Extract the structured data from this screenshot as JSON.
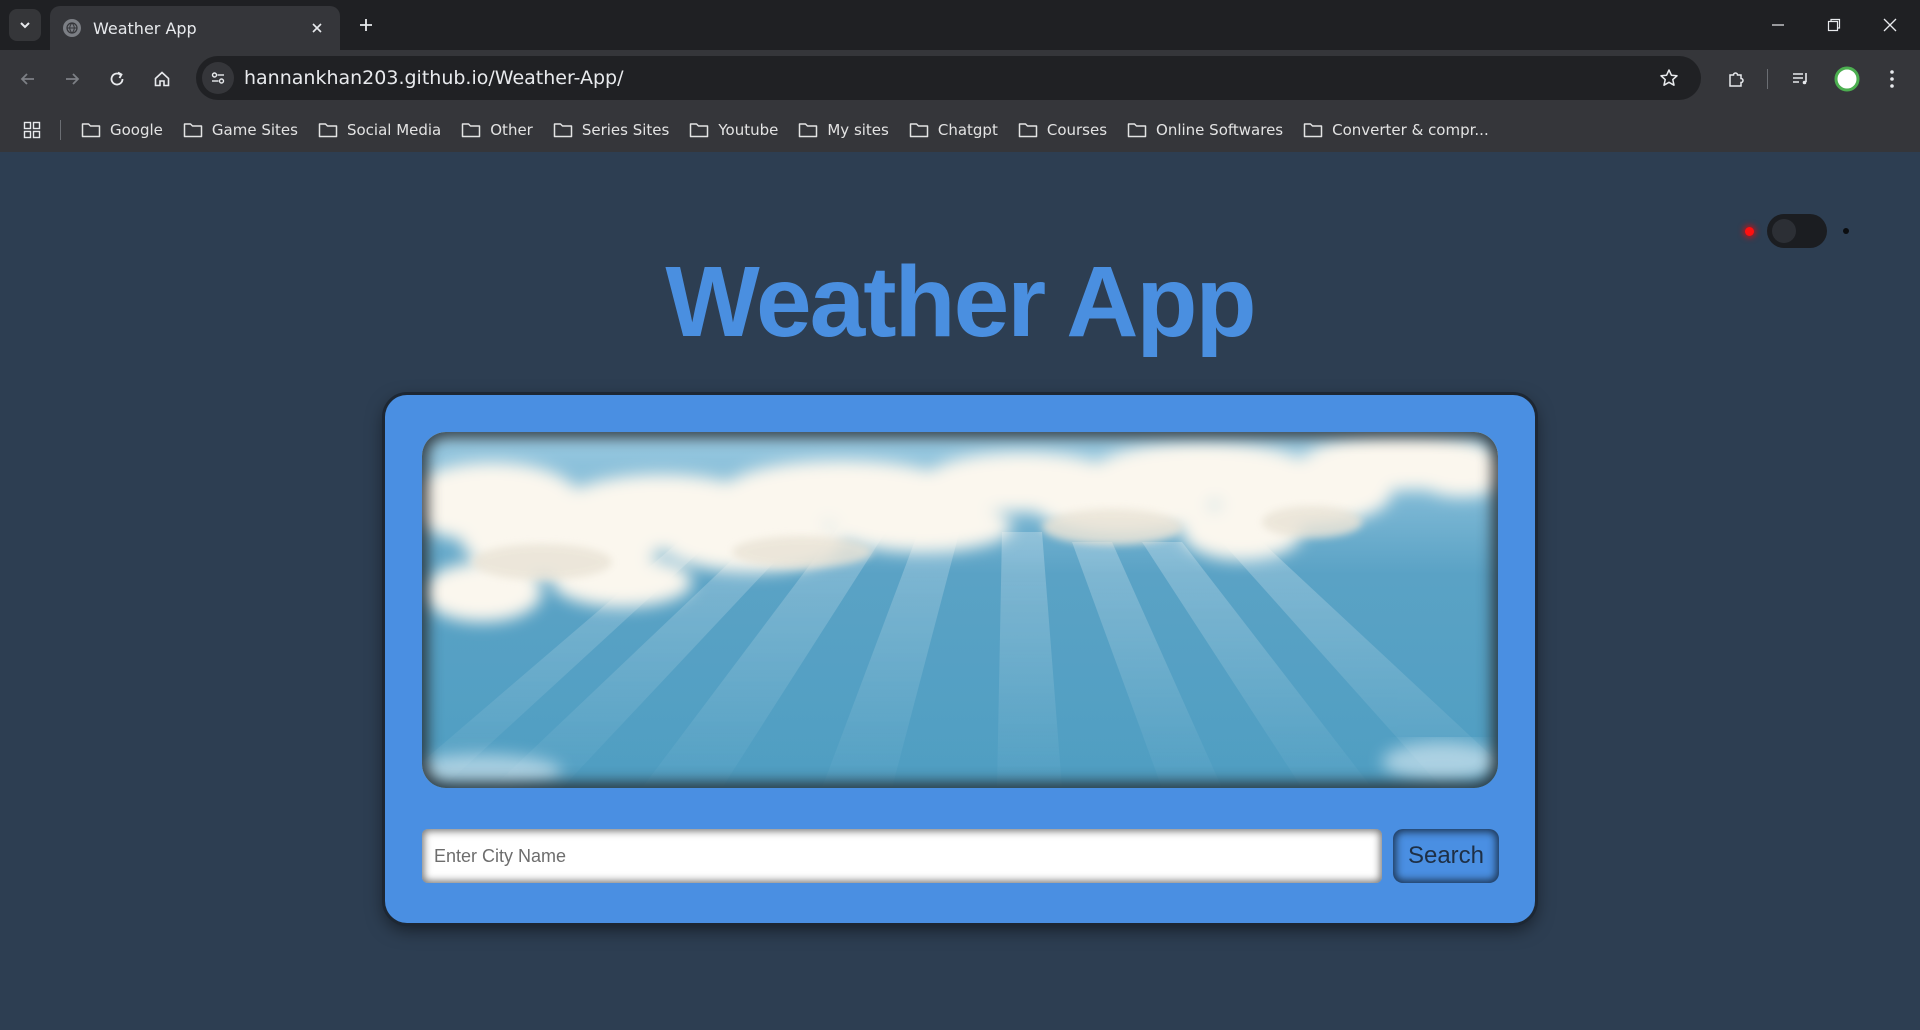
{
  "browser": {
    "tab_title": "Weather App",
    "url": "hannankhan203.github.io/Weather-App/",
    "bookmarks": [
      {
        "label": "Google"
      },
      {
        "label": "Game Sites"
      },
      {
        "label": "Social Media"
      },
      {
        "label": "Other"
      },
      {
        "label": "Series Sites"
      },
      {
        "label": "Youtube"
      },
      {
        "label": "My sites"
      },
      {
        "label": "Chatgpt"
      },
      {
        "label": "Courses"
      },
      {
        "label": "Online Softwares"
      },
      {
        "label": "Converter & compr..."
      }
    ]
  },
  "page": {
    "title": "Weather App",
    "search": {
      "placeholder": "Enter City Name",
      "value": "",
      "button_label": "Search"
    },
    "theme_toggle": {
      "state": "off",
      "indicator_color": "#ff1010"
    }
  },
  "colors": {
    "page_background": "#2d3e52",
    "accent_blue": "#4a8fe2",
    "title_blue": "#4a8fe0",
    "chrome_dark": "#1f2023",
    "chrome_toolbar": "#35363a"
  }
}
